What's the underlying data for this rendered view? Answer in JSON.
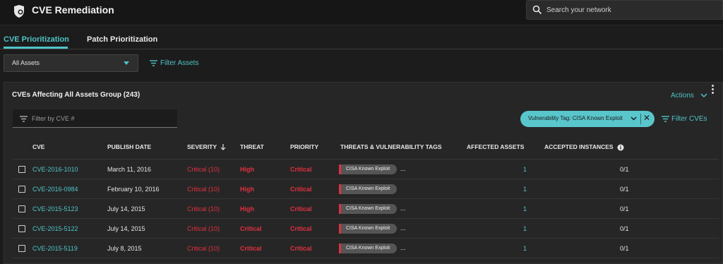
{
  "app": {
    "title": "CVE Remediation"
  },
  "search": {
    "placeholder": "Search your network"
  },
  "tabs": [
    {
      "label": "CVE Prioritization",
      "active": true
    },
    {
      "label": "Patch Prioritization",
      "active": false
    }
  ],
  "asset_select": {
    "value": "All Assets"
  },
  "filter_assets_label": "Filter Assets",
  "panel": {
    "title": "CVEs Affecting All Assets Group (243)",
    "actions_label": "Actions",
    "cve_filter_placeholder": "Filter by CVE #",
    "chip_label": "Vulnerability Tag: CISA Known Exploit",
    "filter_cves_label": "Filter CVEs"
  },
  "table": {
    "headers": {
      "cve": "CVE",
      "publish_date": "PUBLISH DATE",
      "severity": "SEVERITY",
      "threat": "THREAT",
      "priority": "PRIORITY",
      "tags": "THREATS & VULNERABILITY TAGS",
      "affected": "AFFECTED ASSETS",
      "accepted": "ACCEPTED INSTANCES"
    },
    "rows": [
      {
        "cve": "CVE-2016-1010",
        "date": "March 11, 2016",
        "severity": "Critical (10)",
        "threat": "High",
        "priority": "Critical",
        "tag": "CISA Known Exploit",
        "more": "...",
        "affected": "1",
        "accepted": "0/1"
      },
      {
        "cve": "CVE-2016-0984",
        "date": "February 10, 2016",
        "severity": "Critical (10)",
        "threat": "High",
        "priority": "Critical",
        "tag": "CISA Known Exploit",
        "more": "",
        "affected": "1",
        "accepted": "0/1"
      },
      {
        "cve": "CVE-2015-5123",
        "date": "July 14, 2015",
        "severity": "Critical (10)",
        "threat": "High",
        "priority": "Critical",
        "tag": "CISA Known Exploit",
        "more": "...",
        "affected": "1",
        "accepted": "0/1"
      },
      {
        "cve": "CVE-2015-5122",
        "date": "July 14, 2015",
        "severity": "Critical (10)",
        "threat": "Critical",
        "priority": "Critical",
        "tag": "CISA Known Exploit",
        "more": "...",
        "affected": "1",
        "accepted": "0/1"
      },
      {
        "cve": "CVE-2015-5119",
        "date": "July 8, 2015",
        "severity": "Critical (10)",
        "threat": "Critical",
        "priority": "Critical",
        "tag": "CISA Known Exploit",
        "more": "...",
        "affected": "1",
        "accepted": "0/1"
      }
    ]
  },
  "colors": {
    "accent": "#4fc3c8",
    "critical": "#e0303f",
    "background": "#1c1c1c"
  },
  "icons": [
    "shield-logo-icon",
    "search-icon",
    "filter-icon",
    "chevron-down-icon",
    "close-icon",
    "info-icon",
    "sort-down-icon",
    "kebab-menu-icon"
  ]
}
